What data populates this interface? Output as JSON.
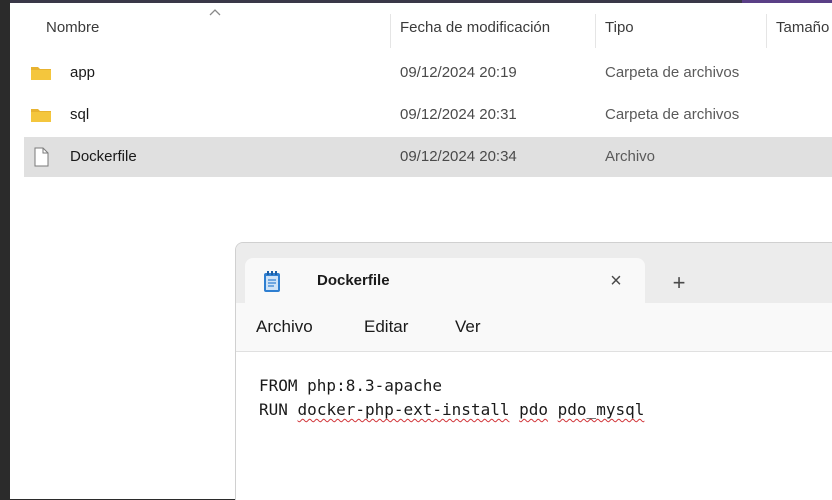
{
  "explorer": {
    "columns": {
      "name": "Nombre",
      "modified": "Fecha de modificación",
      "type": "Tipo",
      "size": "Tamaño"
    },
    "files": [
      {
        "name": "app",
        "modified": "09/12/2024 20:19",
        "type": "Carpeta de archivos",
        "icon": "folder-icon"
      },
      {
        "name": "sql",
        "modified": "09/12/2024 20:31",
        "type": "Carpeta de archivos",
        "icon": "folder-icon"
      },
      {
        "name": "Dockerfile",
        "modified": "09/12/2024 20:34",
        "type": "Archivo",
        "icon": "file-icon",
        "selected": true
      }
    ]
  },
  "notepad": {
    "tab_title": "Dockerfile",
    "close_symbol": "×",
    "new_tab_symbol": "+",
    "menu": {
      "file": "Archivo",
      "edit": "Editar",
      "view": "Ver"
    },
    "lines": {
      "line1": "FROM php:8.3-apache",
      "line2_keyword": "RUN",
      "line2_words": [
        "docker-php-ext-install",
        "pdo",
        "pdo_mysql"
      ]
    }
  },
  "colors": {
    "selected_row": "#e0e0e0",
    "folder": "#f4c63d",
    "notepad_icon": "#2f7fd1",
    "spellcheck": "#d13438"
  }
}
